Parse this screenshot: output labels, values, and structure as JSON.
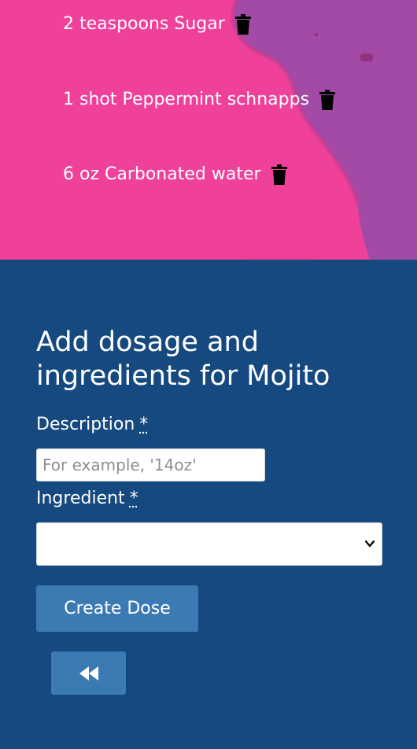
{
  "doses": [
    {
      "text": "2 teaspoons Sugar",
      "icon": "trash-icon"
    },
    {
      "text": "1 shot Peppermint schnapps",
      "icon": "trash-icon"
    },
    {
      "text": "6 oz Carbonated water",
      "icon": "trash-icon"
    }
  ],
  "form": {
    "title": "Add dosage and ingredients for Mojito",
    "description_label": "Description",
    "required_marker": "*",
    "description_placeholder": "For example, '14oz'",
    "ingredient_label": "Ingredient",
    "ingredient_selected": "",
    "submit_label": "Create Dose",
    "back_icon": "fast-backward-icon"
  },
  "colors": {
    "hero_pink": "#f0419a",
    "hero_purple": "#a24aa6",
    "panel_blue": "#15497f",
    "button_blue": "#3c7ab4"
  }
}
